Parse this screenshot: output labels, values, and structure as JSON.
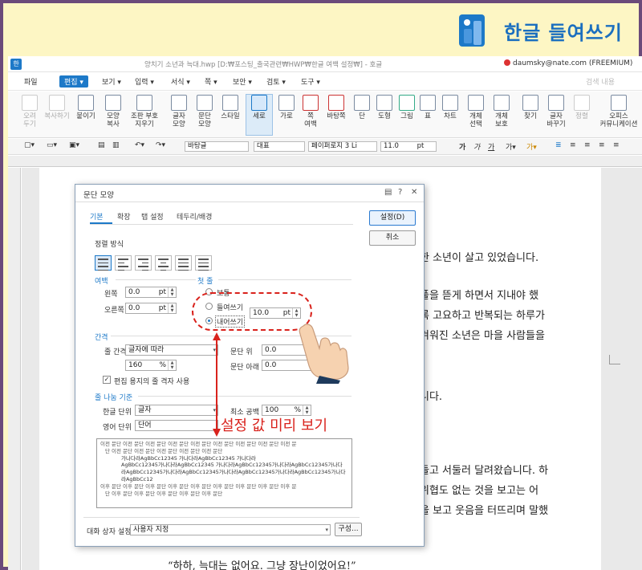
{
  "banner": {
    "title": "한글 들여쓰기"
  },
  "window": {
    "app_icon": "한",
    "title": "양치기 소년과 늑대.hwp [D:₩포스팅_출국관련₩HWP₩한글 여백 설정₩] - 호글",
    "account": "daumsky@nate.com (FREEMIUM)",
    "hint": "검색 내용"
  },
  "menu": [
    "파일",
    "편집 ▾",
    "보기 ▾",
    "입력 ▾",
    "서식 ▾",
    "쪽 ▾",
    "보안 ▾",
    "검토 ▾",
    "도구 ▾"
  ],
  "ribbon": {
    "cut": "오려\n두기",
    "copy": "복사하기",
    "paste": "붙이기",
    "shape_copy": "모양\n복사",
    "clear": "조판 부호\n지우기",
    "char_shape": "글자\n모양",
    "para_shape": "문단\n모양",
    "style": "스타일",
    "portrait": "세로",
    "landscape": "가로",
    "margin": "쪽\n여백",
    "bg": "바탕쪽",
    "col": "단",
    "draw": "도형",
    "picture": "그림",
    "table": "표",
    "chart": "차트",
    "select": "개체\n선택",
    "protect": "개체\n보호",
    "find": "찾기",
    "replace": "글자\n바꾸기",
    "arrange": "정렬",
    "office": "오피스\n커뮤니케이션"
  },
  "format": {
    "style": "바탕글",
    "lang": "대표",
    "font": "페이퍼로지 3 Li",
    "size": "11.0",
    "unit": "pt"
  },
  "doc": {
    "lines": [
      "한 소년이 살고 있었습니다.",
      "풀을 뜯게 하면서 지내야 했",
      "록 고요하고 반복되는 하루가",
      "겨워진 소년은 마을 사람들을",
      "니다.",
      "들고 서둘러 달려왔습니다. 하",
      "위협도 없는 것을 보고는 어",
      "을 보고 웃음을 터뜨리며 말했",
      "“하하, 늑대는 없어요. 그냥 장난이었어요!”"
    ]
  },
  "dialog": {
    "title": "문단 모양",
    "tabs": [
      "기본",
      "확장",
      "탭 설정",
      "테두리/배경"
    ],
    "ok": "설정(D)",
    "cancel": "취소",
    "align_title": "정렬 방식",
    "margin_title": "여백",
    "left_label": "왼쪽",
    "left_value": "0.0",
    "right_label": "오른쪽",
    "right_value": "0.0",
    "unit": "pt",
    "first_title": "첫 줄",
    "first_opts": [
      "보통",
      "들여쓰기",
      "내어쓰기"
    ],
    "first_value": "10.0",
    "spacing_title": "간격",
    "line_label": "줄 간격",
    "line_type": "글자에 따라",
    "line_value": "160",
    "percent": "%",
    "above_label": "문단 위",
    "above_value": "0.0",
    "below_label": "문단 아래",
    "below_value": "0.0",
    "grid_label": "편집 용지의 줄 격자 사용",
    "linebreak_title": "줄 나눔 기준",
    "hangul_label": "한글 단위",
    "hangul_value": "글자",
    "english_label": "영어 단위",
    "english_value": "단어",
    "min_space_label": "최소 공백",
    "min_space_value": "100",
    "preview_lines": [
      "이전 문단 이전 문단 이전 문단 이전 문단 이전 문단 이전 문단 이전 문단 이전 문단 이전 문",
      "단 이전 문단 이전 문단 이전 문단 이전 문단 이전 문단",
      "가나다라AgBbCc12345     가나다라AgBbCc12345     가나다라",
      "AgBbCc12345가나다라AgBbCc12345 가나다라AgBbCc12345가나다라AgBbCc12345가나다",
      "라AgBbCc12345가나다라AgBbCc12345가나다라AgBbCc12345가나다라AgBbCc12345가나다",
      "라AgBbCc12",
      "이후 문단 이후 문단 이후 문단 이후 문단 이후 문단 이후 문단 이후 문단 이후 문단 이후 문",
      "단 이후 문단 이후 문단 이후 문단 이후 문단 이후 문단"
    ],
    "footer_label": "대화 상자 설정",
    "footer_value": "사용자 지정",
    "compose": "구성..."
  },
  "annotation": {
    "label": "설정 값 미리 보기",
    "color": "#d9221c"
  }
}
